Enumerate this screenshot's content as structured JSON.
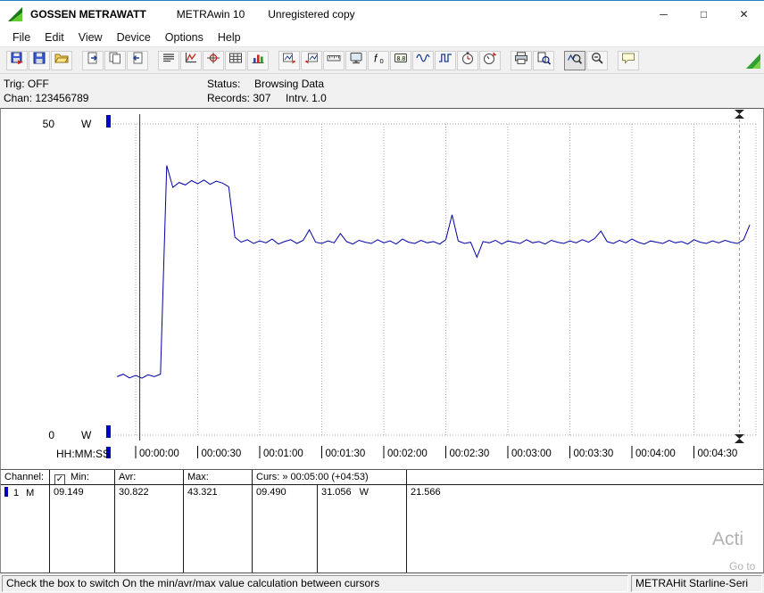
{
  "title": {
    "brand": "GOSSEN METRAWATT",
    "app": "METRAwin 10",
    "license": "Unregistered copy"
  },
  "window_controls": {
    "minimize": "─",
    "maximize": "□",
    "close": "✕"
  },
  "menu": {
    "items": [
      "File",
      "Edit",
      "View",
      "Device",
      "Options",
      "Help"
    ]
  },
  "toolbar": {
    "groups": [
      {
        "buttons": [
          {
            "icon": "file-export-icon"
          },
          {
            "icon": "file-save-icon"
          },
          {
            "icon": "file-open-icon"
          }
        ]
      },
      {
        "buttons": [
          {
            "icon": "page-export-icon"
          },
          {
            "icon": "page-copy-icon"
          },
          {
            "icon": "page-import-icon"
          }
        ]
      },
      {
        "buttons": [
          {
            "icon": "text-view-icon"
          },
          {
            "icon": "yt-chart-icon"
          },
          {
            "icon": "xy-chart-icon"
          },
          {
            "icon": "table-view-icon"
          },
          {
            "icon": "bar-view-icon"
          }
        ]
      },
      {
        "buttons": [
          {
            "icon": "window-back-icon"
          },
          {
            "icon": "window-forward-icon"
          },
          {
            "icon": "scale-icon"
          },
          {
            "icon": "monitor-icon"
          },
          {
            "icon": "function-icon"
          },
          {
            "icon": "display-icon"
          },
          {
            "icon": "analog-wave-icon"
          },
          {
            "icon": "step-wave-icon"
          },
          {
            "icon": "timer-icon"
          },
          {
            "icon": "trigger-icon"
          }
        ]
      },
      {
        "buttons": [
          {
            "icon": "print-icon"
          },
          {
            "icon": "print-preview-icon"
          }
        ]
      },
      {
        "buttons": [
          {
            "icon": "zoom-curve-icon",
            "active": true
          },
          {
            "icon": "zoom-out-icon"
          }
        ]
      },
      {
        "buttons": [
          {
            "icon": "note-icon"
          }
        ]
      }
    ],
    "corner_logo": "green-triangle-logo"
  },
  "status_info": {
    "trig": "Trig: OFF",
    "chan": "Chan: 123456789",
    "status_label": "Status:",
    "status_value": "Browsing Data",
    "records": "Records: 307",
    "interval": "Intrv. 1.0"
  },
  "chart_data": {
    "type": "line",
    "title": "Power recording vs time",
    "ylabel_unit": "W",
    "ylim": [
      0,
      50
    ],
    "y_ticks": [
      {
        "v": 50,
        "label": "50",
        "unit": "W"
      },
      {
        "v": 0,
        "label": "0",
        "unit": "W"
      }
    ],
    "x_axis_label": "HH:MM:SS",
    "x_ticks": [
      {
        "t": 0,
        "label": "00:00:00"
      },
      {
        "t": 30,
        "label": "00:00:30"
      },
      {
        "t": 60,
        "label": "00:01:00"
      },
      {
        "t": 90,
        "label": "00:01:30"
      },
      {
        "t": 120,
        "label": "00:02:00"
      },
      {
        "t": 150,
        "label": "00:02:30"
      },
      {
        "t": 180,
        "label": "00:03:00"
      },
      {
        "t": 210,
        "label": "00:03:30"
      },
      {
        "t": 240,
        "label": "00:04:00"
      },
      {
        "t": 270,
        "label": "00:04:30"
      }
    ],
    "x_end_t": 300,
    "xlim_seconds": [
      -10,
      304
    ],
    "grid": "dotted",
    "legend_position": "none",
    "series": [
      {
        "name": "channel-1",
        "color": "#0000a8",
        "t_start": -9,
        "dt": 3,
        "values": [
          9.4,
          9.8,
          9.2,
          9.6,
          9.15,
          9.7,
          9.4,
          9.8,
          43.32,
          39.8,
          40.6,
          40.2,
          40.9,
          40.4,
          41.0,
          40.3,
          40.8,
          40.5,
          39.9,
          31.8,
          31.0,
          31.4,
          30.8,
          31.2,
          30.9,
          31.5,
          30.7,
          31.1,
          31.4,
          30.8,
          31.3,
          33.0,
          31.0,
          30.8,
          31.2,
          30.9,
          32.4,
          31.1,
          30.7,
          31.3,
          31.0,
          30.8,
          31.4,
          30.9,
          31.2,
          30.7,
          31.5,
          31.0,
          30.8,
          31.3,
          30.9,
          31.1,
          30.7,
          31.4,
          35.4,
          31.2,
          30.8,
          31.0,
          28.6,
          31.1,
          30.9,
          31.3,
          30.7,
          31.2,
          31.0,
          30.8,
          31.4,
          30.9,
          31.1,
          30.7,
          31.3,
          31.0,
          30.8,
          31.2,
          30.9,
          31.4,
          31.0,
          31.6,
          32.8,
          31.1,
          30.8,
          31.3,
          30.9,
          31.5,
          31.0,
          30.7,
          31.2,
          31.0,
          30.8,
          31.3,
          30.9,
          31.1,
          30.7,
          31.4,
          31.0,
          30.8,
          31.2,
          30.9,
          31.3,
          31.0,
          30.8,
          31.4,
          33.8
        ]
      }
    ],
    "cursors": {
      "c1_t": 2,
      "c2_t": 292,
      "c1_style": "solid",
      "c2_style": "dashed-hourglass"
    }
  },
  "cursor_table": {
    "header": {
      "channel": "Channel:",
      "checkbox_checked": "✓",
      "min": "Min:",
      "avr": "Avr:",
      "max": "Max:",
      "curs": "Curs: » 00:05:00 (+04:53)"
    },
    "row": {
      "channel": "1",
      "mode": "M",
      "min": "09.149",
      "avr": "30.822",
      "max": "43.321",
      "cursor1": "09.490",
      "cursor2": "31.056",
      "unit": "W",
      "delta": "21.566"
    }
  },
  "status_bar": {
    "message": "Check the box to switch On the min/avr/max value calculation between cursors",
    "device": "METRAHit Starline-Seri"
  },
  "watermark": {
    "line1": "Acti",
    "line2": "Go to"
  }
}
